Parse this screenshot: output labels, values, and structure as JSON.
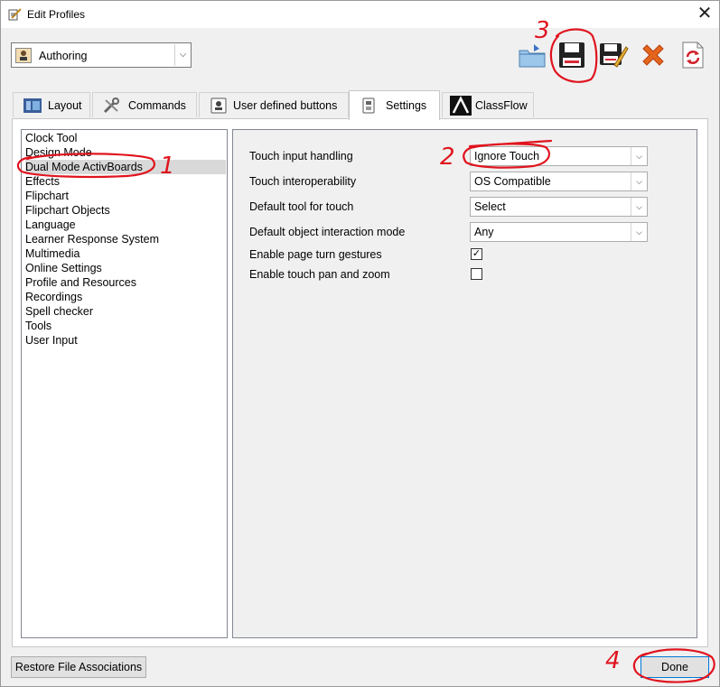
{
  "window": {
    "title": "Edit Profiles",
    "close_glyph": "✕"
  },
  "profile": {
    "selected": "Authoring",
    "icon": "profile-card-icon"
  },
  "toolbar": {
    "icons": [
      "new-profile-icon",
      "save-icon",
      "save-as-icon",
      "delete-icon",
      "refresh-icon"
    ]
  },
  "tabs": [
    {
      "label": "Layout",
      "icon": "layout-icon"
    },
    {
      "label": "Commands",
      "icon": "tools-icon"
    },
    {
      "label": "User defined buttons",
      "icon": "user-button-icon"
    },
    {
      "label": "Settings",
      "icon": "settings-icon",
      "active": true
    },
    {
      "label": "ClassFlow",
      "icon": "classflow-icon"
    }
  ],
  "categories": [
    "Clock Tool",
    "Design Mode",
    "Dual Mode ActivBoards",
    "Effects",
    "Flipchart",
    "Flipchart Objects",
    "Language",
    "Learner Response System",
    "Multimedia",
    "Online Settings",
    "Profile and Resources",
    "Recordings",
    "Spell checker",
    "Tools",
    "User Input"
  ],
  "selected_category": "Dual Mode ActivBoards",
  "settings": {
    "touch_input_label": "Touch input handling",
    "touch_input_value": "Ignore Touch",
    "interop_label": "Touch interoperability",
    "interop_value": "OS Compatible",
    "default_tool_label": "Default tool for touch",
    "default_tool_value": "Select",
    "interaction_label": "Default object interaction mode",
    "interaction_value": "Any",
    "page_turn_label": "Enable page turn gestures",
    "page_turn_checked": true,
    "pan_zoom_label": "Enable touch pan and zoom",
    "pan_zoom_checked": false
  },
  "buttons": {
    "restore": "Restore File Associations",
    "done": "Done"
  },
  "annotations": {
    "marks": [
      "1",
      "2",
      "3",
      "4"
    ],
    "color": "#e0141e"
  },
  "colors": {
    "selection": "#d9d9d9",
    "done_border": "#0078d7"
  }
}
